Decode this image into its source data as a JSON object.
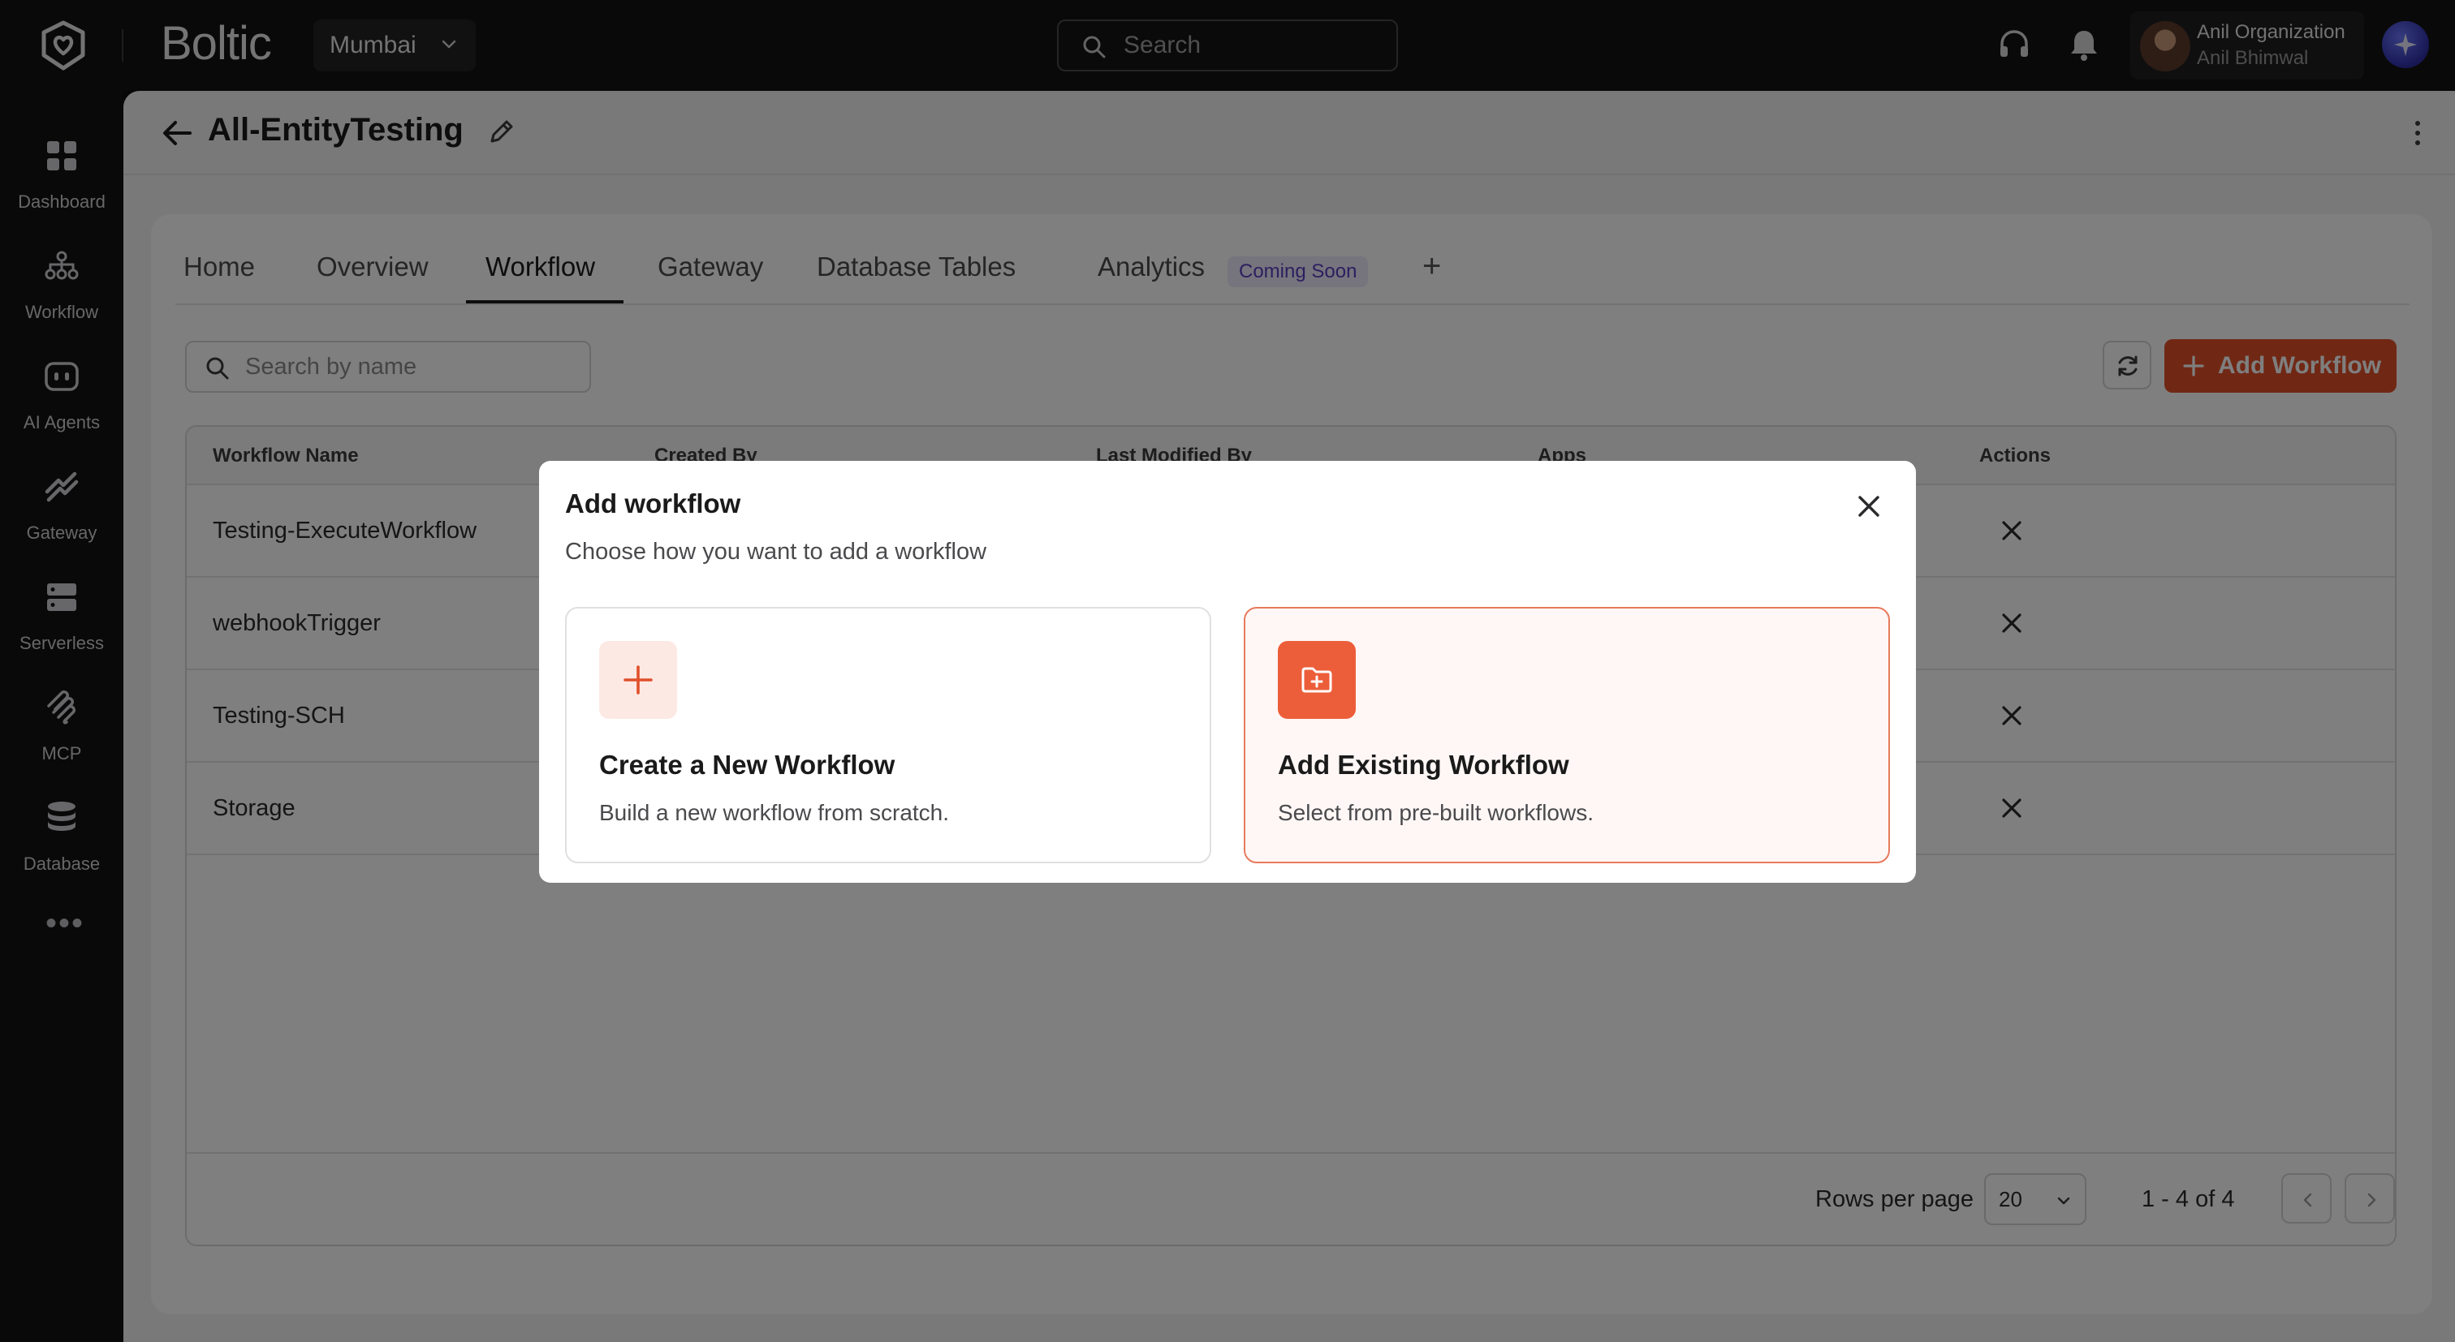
{
  "header": {
    "brand": "Boltic",
    "region": "Mumbai",
    "search_placeholder": "Search",
    "profile_org": "Anil Organization",
    "profile_user": "Anil Bhimwal"
  },
  "sidebar": {
    "items": [
      {
        "label": "Dashboard",
        "icon": "dashboard-icon"
      },
      {
        "label": "Workflow",
        "icon": "workflow-icon"
      },
      {
        "label": "AI Agents",
        "icon": "ai-agents-icon"
      },
      {
        "label": "Gateway",
        "icon": "gateway-icon"
      },
      {
        "label": "Serverless",
        "icon": "serverless-icon"
      },
      {
        "label": "MCP",
        "icon": "mcp-icon"
      },
      {
        "label": "Database",
        "icon": "database-icon"
      }
    ],
    "more": "•••"
  },
  "page": {
    "title": "All-EntityTesting"
  },
  "tabs": {
    "home": "Home",
    "overview": "Overview",
    "workflow": "Workflow",
    "gateway": "Gateway",
    "database_tables": "Database Tables",
    "analytics": "Analytics",
    "analytics_badge": "Coming Soon",
    "add": "+",
    "active": "Workflow"
  },
  "toolbar": {
    "search_placeholder": "Search by name",
    "add_label": "Add Workflow"
  },
  "table": {
    "columns": [
      "Workflow Name",
      "Created By",
      "Last Modified By",
      "Apps",
      "Actions"
    ],
    "rows": [
      {
        "name": "Testing-ExecuteWorkflow"
      },
      {
        "name": "webhookTrigger"
      },
      {
        "name": "Testing-SCH"
      },
      {
        "name": "Storage"
      }
    ]
  },
  "pagination": {
    "rows_per_page_label": "Rows per page",
    "rows_per_page_value": "20",
    "range": "1 - 4 of 4"
  },
  "modal": {
    "title": "Add workflow",
    "subtitle": "Choose how you want to add a workflow",
    "options": [
      {
        "title": "Create a New Workflow",
        "desc": "Build a new workflow from scratch.",
        "icon": "plus-icon"
      },
      {
        "title": "Add Existing Workflow",
        "desc": "Select from pre-built workflows.",
        "icon": "folder-add-icon"
      }
    ]
  },
  "colors": {
    "accent": "#e0502b",
    "badge_text": "#5a3fc0",
    "badge_bg": "#ece8fb"
  }
}
